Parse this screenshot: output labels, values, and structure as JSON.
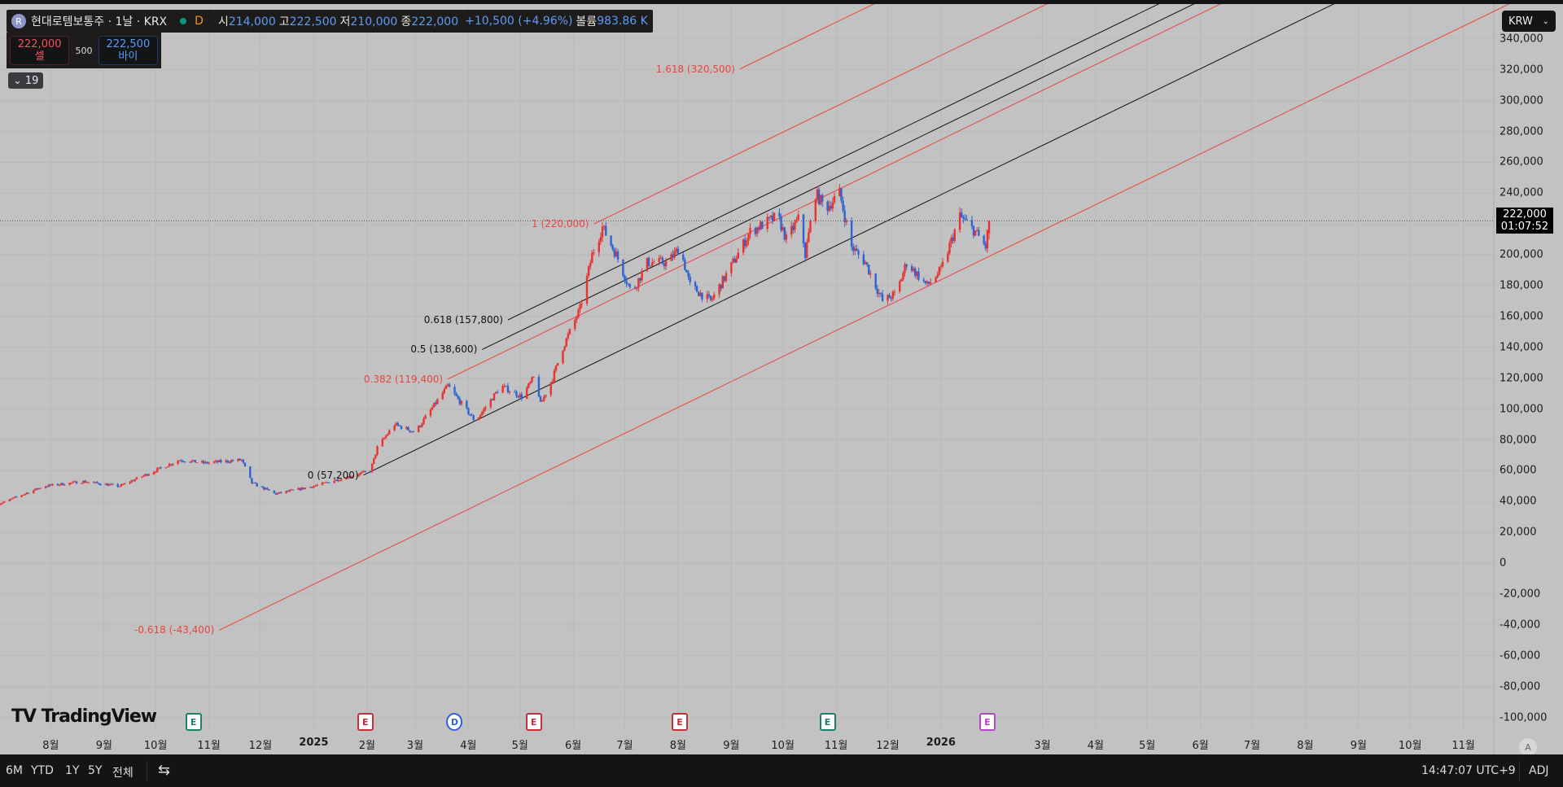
{
  "header": {
    "symbol_badge": "R",
    "title": "현대로템보통주 · 1날 · KRX",
    "interval_badge": "D",
    "ohlc": [
      {
        "k": "시",
        "v": "214,000"
      },
      {
        "k": "고",
        "v": "222,500"
      },
      {
        "k": "저",
        "v": "210,000"
      },
      {
        "k": "종",
        "v": "222,000"
      }
    ],
    "change": "+10,500 (+4.96%)",
    "volume_label": "볼륨",
    "volume": "983.86 K"
  },
  "trade": {
    "sell_price": "222,000",
    "sell_label": "셀",
    "qty": "500",
    "buy_price": "222,500",
    "buy_label": "바이"
  },
  "indicators_toggle": "19",
  "currency": "KRW",
  "last_price": {
    "value": 222000,
    "label": "222,000",
    "countdown": "01:07:52"
  },
  "colors": {
    "up": "#e8322f",
    "down": "#2d63d4",
    "fib_red": "#e8443f",
    "fib_black": "#111111",
    "bg": "#c2c2c2"
  },
  "price_axis": [
    "340,000",
    "320,000",
    "300,000",
    "280,000",
    "260,000",
    "240,000",
    "220,000",
    "200,000",
    "180,000",
    "160,000",
    "140,000",
    "120,000",
    "100,000",
    "80,000",
    "60,000",
    "40,000",
    "20,000",
    "0",
    "-20,000",
    "-40,000",
    "-60,000",
    "-80,000",
    "-100,000"
  ],
  "time_axis": [
    {
      "d": "2024-08-01",
      "l": "8월"
    },
    {
      "d": "2024-09-01",
      "l": "9월"
    },
    {
      "d": "2024-10-01",
      "l": "10월"
    },
    {
      "d": "2024-11-01",
      "l": "11월"
    },
    {
      "d": "2024-12-01",
      "l": "12월"
    },
    {
      "d": "2025-01-01",
      "l": "2025",
      "b": true
    },
    {
      "d": "2025-02-01",
      "l": "2월"
    },
    {
      "d": "2025-03-01",
      "l": "3월"
    },
    {
      "d": "2025-04-01",
      "l": "4월"
    },
    {
      "d": "2025-05-01",
      "l": "5월"
    },
    {
      "d": "2025-06-01",
      "l": "6월"
    },
    {
      "d": "2025-07-01",
      "l": "7월"
    },
    {
      "d": "2025-08-01",
      "l": "8월"
    },
    {
      "d": "2025-09-01",
      "l": "9월"
    },
    {
      "d": "2025-10-01",
      "l": "10월"
    },
    {
      "d": "2025-11-01",
      "l": "11월"
    },
    {
      "d": "2025-12-01",
      "l": "12월"
    },
    {
      "d": "2026-01-01",
      "l": "2026",
      "b": true
    },
    {
      "d": "2026-03-01",
      "l": "3월"
    },
    {
      "d": "2026-04-01",
      "l": "4월"
    },
    {
      "d": "2026-05-01",
      "l": "5월"
    },
    {
      "d": "2026-06-01",
      "l": "6월"
    },
    {
      "d": "2026-07-01",
      "l": "7월"
    },
    {
      "d": "2026-08-01",
      "l": "8월"
    },
    {
      "d": "2026-09-01",
      "l": "9월"
    },
    {
      "d": "2026-10-01",
      "l": "10월"
    },
    {
      "d": "2026-11-01",
      "l": "11월"
    }
  ],
  "events": [
    {
      "d": "2024-10-23",
      "t": "E",
      "c": "#1b7f6a"
    },
    {
      "d": "2025-01-31",
      "t": "E",
      "c": "#c2303a"
    },
    {
      "d": "2025-03-24",
      "t": "D",
      "c": "#2d63d4"
    },
    {
      "d": "2025-05-09",
      "t": "E",
      "c": "#c2303a"
    },
    {
      "d": "2025-08-02",
      "t": "E",
      "c": "#c2303a"
    },
    {
      "d": "2025-10-27",
      "t": "E",
      "c": "#1b7f6a"
    },
    {
      "d": "2026-01-28",
      "t": "E",
      "c": "#b545c9"
    }
  ],
  "fib_channel": {
    "slope_krw_per_day": 541,
    "levels": [
      {
        "label": "-0.618 (-43,400)",
        "price": -43400,
        "start": "2024-11-07",
        "color": "red"
      },
      {
        "label": "0 (57,200)",
        "price": 57200,
        "start": "2025-01-30",
        "color": "black"
      },
      {
        "label": "0.382 (119,400)",
        "price": 119400,
        "start": "2025-03-20",
        "color": "red"
      },
      {
        "label": "0.5 (138,600)",
        "price": 138600,
        "start": "2025-04-09",
        "color": "black"
      },
      {
        "label": "0.618 (157,800)",
        "price": 157800,
        "start": "2025-04-24",
        "color": "black"
      },
      {
        "label": "1 (220,000)",
        "price": 220000,
        "start": "2025-06-13",
        "color": "red"
      },
      {
        "label": "1.618 (320,500)",
        "price": 320500,
        "start": "2025-09-06",
        "color": "red"
      }
    ]
  },
  "chart_data": {
    "type": "candlestick",
    "ylim": [
      -100000,
      340000
    ],
    "close_path": [
      [
        "2024-07-01",
        38000
      ],
      [
        "2024-07-28",
        50000
      ],
      [
        "2024-08-20",
        53000
      ],
      [
        "2024-09-10",
        50000
      ],
      [
        "2024-10-15",
        67000
      ],
      [
        "2024-10-30",
        65000
      ],
      [
        "2024-11-20",
        67000
      ],
      [
        "2024-11-26",
        52000
      ],
      [
        "2024-12-10",
        45000
      ],
      [
        "2025-01-01",
        50000
      ],
      [
        "2025-02-03",
        60000
      ],
      [
        "2025-02-07",
        75000
      ],
      [
        "2025-02-17",
        90000
      ],
      [
        "2025-03-01",
        85000
      ],
      [
        "2025-03-20",
        115000
      ],
      [
        "2025-04-05",
        92000
      ],
      [
        "2025-04-20",
        115000
      ],
      [
        "2025-05-02",
        108000
      ],
      [
        "2025-05-10",
        122000
      ],
      [
        "2025-05-13",
        103000
      ],
      [
        "2025-05-20",
        120000
      ],
      [
        "2025-05-26",
        140000
      ],
      [
        "2025-06-05",
        165000
      ],
      [
        "2025-06-12",
        200000
      ],
      [
        "2025-06-18",
        218000
      ],
      [
        "2025-06-26",
        200000
      ],
      [
        "2025-07-05",
        175000
      ],
      [
        "2025-07-14",
        195000
      ],
      [
        "2025-07-26",
        195000
      ],
      [
        "2025-08-02",
        205000
      ],
      [
        "2025-08-08",
        180000
      ],
      [
        "2025-08-20",
        170000
      ],
      [
        "2025-08-28",
        185000
      ],
      [
        "2025-09-12",
        215000
      ],
      [
        "2025-09-28",
        225000
      ],
      [
        "2025-10-03",
        210000
      ],
      [
        "2025-10-11",
        225000
      ],
      [
        "2025-10-14",
        200000
      ],
      [
        "2025-10-20",
        240000
      ],
      [
        "2025-10-26",
        230000
      ],
      [
        "2025-11-03",
        240000
      ],
      [
        "2025-11-10",
        205000
      ],
      [
        "2025-11-18",
        195000
      ],
      [
        "2025-11-28",
        170000
      ],
      [
        "2025-12-06",
        175000
      ],
      [
        "2025-12-12",
        195000
      ],
      [
        "2025-12-24",
        180000
      ],
      [
        "2026-01-01",
        190000
      ],
      [
        "2026-01-12",
        225000
      ],
      [
        "2026-01-21",
        215000
      ],
      [
        "2026-01-27",
        205000
      ],
      [
        "2026-01-29",
        222000
      ]
    ],
    "last_candle": {
      "open": 214000,
      "high": 222500,
      "low": 210000,
      "close": 222000
    }
  },
  "logo": "TradingView",
  "auto_scale": "A",
  "bottom": {
    "ranges": [
      "6M",
      "YTD",
      "1Y",
      "5Y",
      "전체"
    ],
    "clock": "14:47:07 UTC+9",
    "adj": "ADJ"
  }
}
